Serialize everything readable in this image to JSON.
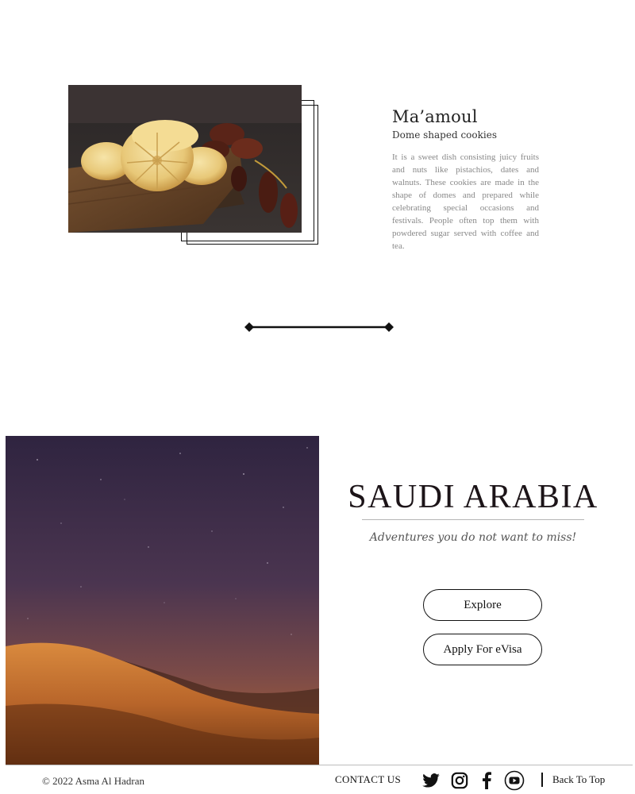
{
  "food": {
    "title": "Ma’amoul",
    "subtitle": "Dome shaped cookies",
    "description": "It is a sweet dish consisting juicy fruits and nuts like pistachios, dates and walnuts. These cookies are made in the shape of domes and prepared while celebrating special occasions and festivals. People often top them with powdered sugar served with coffee and tea."
  },
  "hero": {
    "title": "SAUDI ARABIA",
    "tagline": "Adventures you do not want to miss!",
    "explore_label": "Explore",
    "evisa_label": "Apply For eVisa"
  },
  "footer": {
    "copyright": "© 2022 Asma Al Hadran",
    "contact_label": "CONTACT US",
    "social_icons": [
      "twitter-icon",
      "instagram-icon",
      "facebook-icon",
      "youtube-icon"
    ],
    "back_to_top_label": "Back To Top"
  },
  "colors": {
    "accent": "#111111",
    "title": "#1c1418",
    "body_text": "#888888"
  }
}
